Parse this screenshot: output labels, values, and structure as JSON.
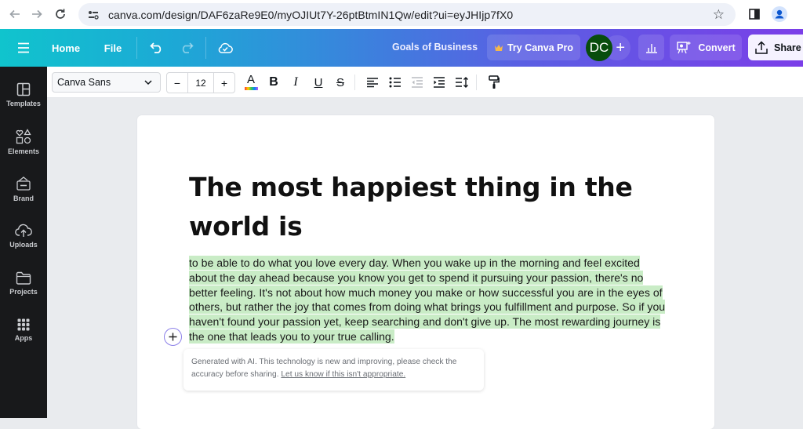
{
  "browser": {
    "url": "canva.com/design/DAF6zaRe9E0/myOJIUt7Y-26ptBtmIN1Qw/edit?ui=eyJHIjp7fX0",
    "icons": [
      "back-arrow-icon",
      "forward-arrow-icon",
      "reload-icon",
      "site-info-icon",
      "bookmark-star-icon",
      "side-panel-icon",
      "profile-icon",
      "more-vert-icon"
    ]
  },
  "header": {
    "menu_icon": "hamburger-icon",
    "home_label": "Home",
    "file_label": "File",
    "doc_title": "Goals of Business",
    "try_pro_label": "Try Canva Pro",
    "avatar_initials": "DC",
    "add_label": "+",
    "convert_label": "Convert",
    "share_label": "Share",
    "colors": {
      "gradient_start": "#10c4cd",
      "gradient_end": "#7b3ee8",
      "avatar_bg": "#084d0d",
      "crown": "#f5b84a"
    }
  },
  "sidebar": {
    "items": [
      {
        "label": "Templates",
        "icon": "templates-icon"
      },
      {
        "label": "Elements",
        "icon": "elements-icon"
      },
      {
        "label": "Brand",
        "icon": "brand-icon"
      },
      {
        "label": "Uploads",
        "icon": "uploads-icon"
      },
      {
        "label": "Projects",
        "icon": "projects-icon"
      },
      {
        "label": "Apps",
        "icon": "apps-icon"
      }
    ]
  },
  "toolbar": {
    "font_family": "Canva Sans",
    "font_size": "12",
    "decrease_label": "−",
    "increase_label": "+",
    "text_color_label": "A",
    "bold_label": "B",
    "italic_label": "I",
    "underline_label": "U",
    "strikethrough_label": "S"
  },
  "document": {
    "heading": "The most happiest thing in the world is",
    "body": "to be able to do what you love every day. When you wake up in the morning and feel excited about the day ahead because you know you get to spend it pursuing your passion, there's no better feeling. It's not about how much money you make or how successful you are in the eyes of others, but rather the joy that comes from doing what brings you fulfillment and purpose. So if you haven't found your passion yet, keep searching and don't give up. The most rewarding journey is the one that leads you to your true calling.",
    "highlight_color": "#c9ecc6",
    "ai_note": "Generated with AI. This technology is new and improving, please check the accuracy before sharing.",
    "ai_note_link": "Let us know if this isn't appropriate."
  }
}
